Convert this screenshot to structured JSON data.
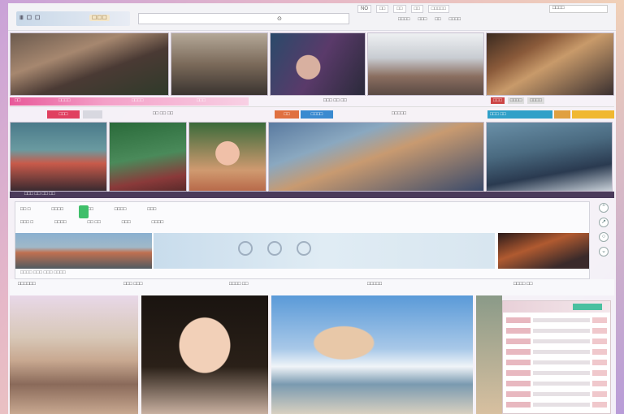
{
  "topnav": {
    "logo": "Ⅲ ☐ ☐",
    "logo_badge": "☐☐☐",
    "search_label": "⊙",
    "tabs": [
      "NO",
      "□□",
      "□□",
      "□□",
      "□□□□□"
    ],
    "right_items": [
      "□□□□",
      "□□□",
      "□□",
      "□□□□"
    ],
    "user": "□□□□"
  },
  "strip": {
    "left_labels": [
      "□□",
      "□□□□",
      "□□□□",
      "□□□"
    ],
    "mid_text": "□□□ □□ □□",
    "tabs": [
      "□□□",
      "□□□□",
      "□□□□"
    ]
  },
  "subnav": {
    "red_button": "□□□",
    "mid_text": "□□ □□ □□",
    "orange_button": "□□",
    "blue_button": "□□□□",
    "right_text": "□□□□□",
    "teal_button": "□□□ □□"
  },
  "darkline": "□□□ □□ □□ □□",
  "panel": {
    "row1": [
      "□□ □",
      "□□□□",
      "□□□",
      "□□□□",
      "□□□"
    ],
    "row2": [
      "□□□ □",
      "□□□□",
      "□□ □□",
      "□□□",
      "□□□□"
    ],
    "footer": "□□□□ □□□ □□□ □□□□"
  },
  "infobar": {
    "cols": [
      "□□□□□□",
      "□□□ □□□",
      "□□□□ □□",
      "□□□□□",
      "□□□□ □□"
    ]
  },
  "colors": {
    "accent_pink": "#e85a9a",
    "accent_red": "#e04060",
    "accent_blue": "#3a8ad0",
    "accent_green": "#3fbf6a"
  }
}
